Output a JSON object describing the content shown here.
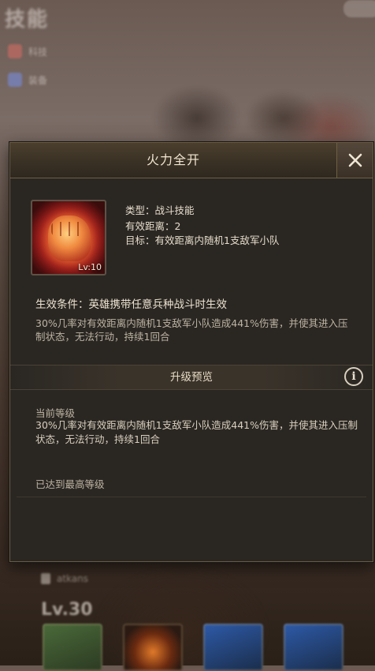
{
  "background": {
    "title": "技能",
    "side_items": [
      {
        "label": "科技",
        "icon": "scroll-icon"
      },
      {
        "label": "装备",
        "icon": "gear-icon"
      }
    ],
    "hero_level": "Lv.30",
    "hero_name": "atkans"
  },
  "dialog": {
    "title": "火力全开",
    "close_icon": "close-icon",
    "skill": {
      "icon": "fist-fire-icon",
      "level": "Lv:10",
      "type": "类型：战斗技能",
      "range": "有效距离：2",
      "target": "目标：有效距离内随机1支敌军小队"
    },
    "condition": "生效条件：英雄携带任意兵种战斗时生效",
    "description": "30%几率对有效距离内随机1支敌军小队造成441%伤害，并使其进入压制状态，无法行动，持续1回合",
    "upgrade": {
      "title": "升级预览",
      "info_icon": "info-icon",
      "current_label": "当前等级",
      "current_desc": "30%几率对有效距离内随机1支敌军小队造成441%伤害，并使其进入压制状态，无法行动，持续1回合",
      "max_text": "已达到最高等级"
    }
  }
}
